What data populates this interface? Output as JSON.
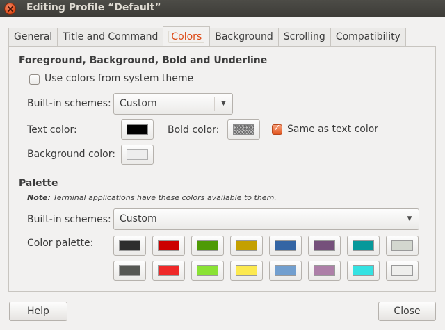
{
  "window": {
    "title": "Editing Profile “Default”"
  },
  "tabs": [
    "General",
    "Title and Command",
    "Colors",
    "Background",
    "Scrolling",
    "Compatibility"
  ],
  "active_tab": "Colors",
  "fg_section": {
    "heading": "Foreground, Background, Bold and Underline",
    "use_system_colors": {
      "label": "Use colors from system theme",
      "checked": false
    },
    "schemes": {
      "label": "Built-in schemes:",
      "value": "Custom"
    },
    "text_color": {
      "label": "Text color:",
      "color": "#000000"
    },
    "bold_color": {
      "label": "Bold color:"
    },
    "same_as_text": {
      "label": "Same as text color",
      "checked": true
    },
    "background_color": {
      "label": "Background color:",
      "color": "#ededed"
    }
  },
  "palette_section": {
    "heading": "Palette",
    "note_bold": "Note:",
    "note_text": " Terminal applications have these colors available to them.",
    "schemes": {
      "label": "Built-in schemes:",
      "value": "Custom"
    },
    "palette_label": "Color palette:",
    "colors_row1": [
      "#2e2e2e",
      "#cc0000",
      "#4e9a06",
      "#c4a000",
      "#3465a4",
      "#75507b",
      "#06989a",
      "#d3d7cf"
    ],
    "colors_row2": [
      "#555753",
      "#ef2929",
      "#8ae234",
      "#fce94f",
      "#729fcf",
      "#ad7fa8",
      "#34e2e2",
      "#eeeeec"
    ]
  },
  "buttons": {
    "help": "Help",
    "close": "Close"
  }
}
